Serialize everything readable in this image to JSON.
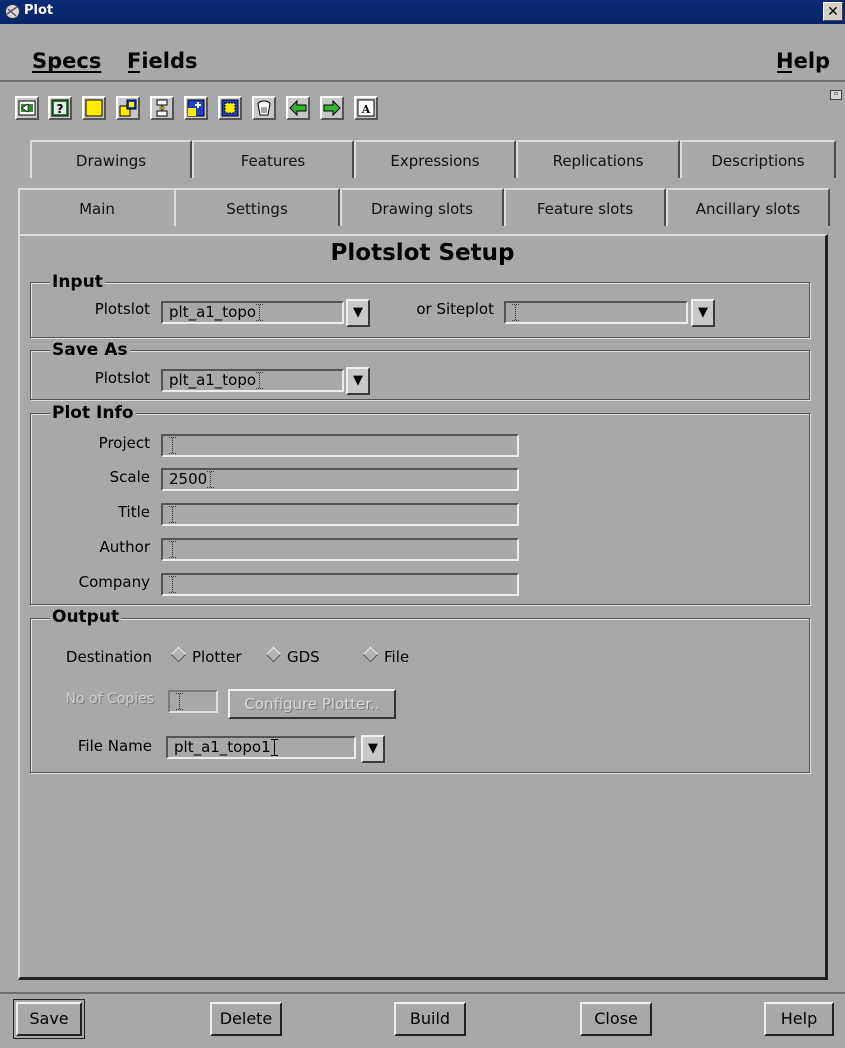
{
  "window": {
    "title": "Plot",
    "close_glyph": "✕"
  },
  "menubar": {
    "specs": "Specs",
    "fields": "Fields",
    "help": "Help"
  },
  "toolbar": {
    "icons": [
      "exit-icon",
      "help-icon",
      "new-icon",
      "copy-icon",
      "tree-icon",
      "add-icon",
      "select-icon",
      "delete-icon",
      "back-icon",
      "forward-icon",
      "text-icon"
    ]
  },
  "tabs_back": [
    "Drawings",
    "Features",
    "Expressions",
    "Replications",
    "Descriptions"
  ],
  "tabs_front": [
    "Main",
    "Settings",
    "Drawing slots",
    "Feature slots",
    "Ancillary slots"
  ],
  "heading": "Plotslot Setup",
  "input": {
    "title": "Input",
    "plotslot_label": "Plotslot",
    "plotslot_value": "plt_a1_topo",
    "siteplot_label": "or Siteplot",
    "siteplot_value": ""
  },
  "save_as": {
    "title": "Save As",
    "plotslot_label": "Plotslot",
    "plotslot_value": "plt_a1_topo"
  },
  "plot_info": {
    "title": "Plot Info",
    "project_label": "Project",
    "project_value": "",
    "scale_label": "Scale",
    "scale_value": "2500",
    "title_label": "Title",
    "title_value": "",
    "author_label": "Author",
    "author_value": "",
    "company_label": "Company",
    "company_value": ""
  },
  "output": {
    "title": "Output",
    "destination_label": "Destination",
    "options": [
      "Plotter",
      "GDS",
      "File"
    ],
    "copies_label": "No of Copies",
    "copies_value": "",
    "configure_label": "Configure Plotter..",
    "filename_label": "File Name",
    "filename_value": "plt_a1_topo1"
  },
  "footer": {
    "save": "Save",
    "delete": "Delete",
    "build": "Build",
    "close": "Close",
    "help": "Help"
  },
  "colors": {
    "background": "#a8a8a8",
    "titlebar": "#0a246a"
  }
}
